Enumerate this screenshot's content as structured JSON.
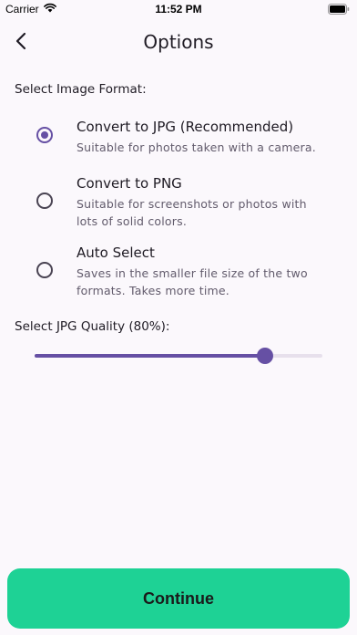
{
  "status_bar": {
    "carrier": "Carrier",
    "time": "11:52 PM"
  },
  "header": {
    "title": "Options",
    "back_icon": "chevron-left-icon"
  },
  "format_section": {
    "label": "Select Image Format:",
    "selected": "jpg",
    "options": [
      {
        "id": "jpg",
        "title": "Convert to JPG (Recommended)",
        "description": "Suitable for photos taken with a camera.",
        "checked": true
      },
      {
        "id": "png",
        "title": "Convert to PNG",
        "description": "Suitable for screenshots or photos with lots of solid colors.",
        "checked": false
      },
      {
        "id": "auto",
        "title": "Auto Select",
        "description": "Saves in the smaller file size of the two formats. Takes more time.",
        "checked": false
      }
    ]
  },
  "quality_section": {
    "label": "Select JPG Quality (80%):",
    "value_percent": 80
  },
  "continue_button": {
    "label": "Continue"
  },
  "colors": {
    "accent": "#6650a4",
    "continue_bg": "#1ed295",
    "background": "#fbf8fc"
  }
}
